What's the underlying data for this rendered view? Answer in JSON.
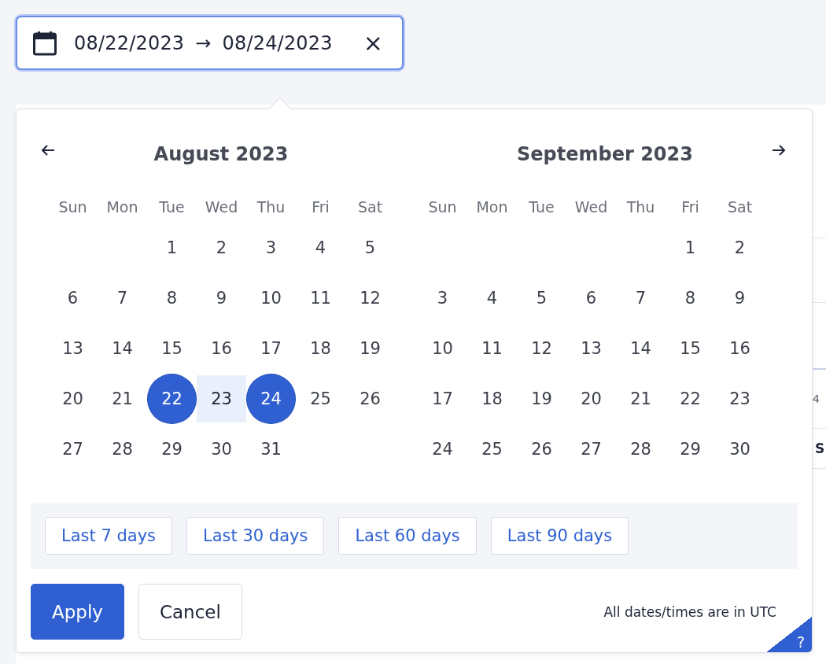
{
  "date_range_field": {
    "start": "08/22/2023",
    "separator": "→",
    "end": "08/24/2023",
    "clear": "×",
    "focused": true
  },
  "background_table": {
    "fragments": [
      "4",
      "S"
    ]
  },
  "months": [
    {
      "title": "August 2023",
      "weekdays": [
        "Sun",
        "Mon",
        "Tue",
        "Wed",
        "Thu",
        "Fri",
        "Sat"
      ],
      "weeks": [
        {
          "kind": "first",
          "days": [
            "1",
            "2",
            "3",
            "4",
            "5"
          ]
        },
        {
          "kind": "full",
          "days": [
            "6",
            "7",
            "8",
            "9",
            "10",
            "11",
            "12"
          ]
        },
        {
          "kind": "full",
          "days": [
            "13",
            "14",
            "15",
            "16",
            "17",
            "18",
            "19"
          ]
        },
        {
          "kind": "full",
          "days": [
            "20",
            "21",
            {
              "label": "22",
              "selected": true
            },
            {
              "label": "23",
              "in_range": true
            },
            {
              "label": "24",
              "selected": true
            },
            "25",
            "26"
          ]
        },
        {
          "kind": "last",
          "days": [
            "27",
            "28",
            "29",
            "30",
            "31"
          ]
        }
      ]
    },
    {
      "title": "September 2023",
      "weekdays": [
        "Sun",
        "Mon",
        "Tue",
        "Wed",
        "Thu",
        "Fri",
        "Sat"
      ],
      "weeks": [
        {
          "kind": "first",
          "days": [
            "1",
            "2"
          ]
        },
        {
          "kind": "full",
          "days": [
            "3",
            "4",
            "5",
            "6",
            "7",
            "8",
            "9"
          ]
        },
        {
          "kind": "full",
          "days": [
            "10",
            "11",
            "12",
            "13",
            "14",
            "15",
            "16"
          ]
        },
        {
          "kind": "full",
          "days": [
            "17",
            "18",
            "19",
            "20",
            "21",
            "22",
            "23"
          ]
        },
        {
          "kind": "last",
          "days": [
            "24",
            "25",
            "26",
            "27",
            "28",
            "29",
            "30"
          ]
        }
      ]
    }
  ],
  "presets": [
    "Last 7 days",
    "Last 30 days",
    "Last 60 days",
    "Last 90 days"
  ],
  "buttons": [
    {
      "label": "Apply",
      "kind": "primary"
    },
    {
      "label": "Cancel",
      "kind": "secondary"
    }
  ],
  "timezone_note": "All dates/times are in UTC",
  "help_badge": "?"
}
